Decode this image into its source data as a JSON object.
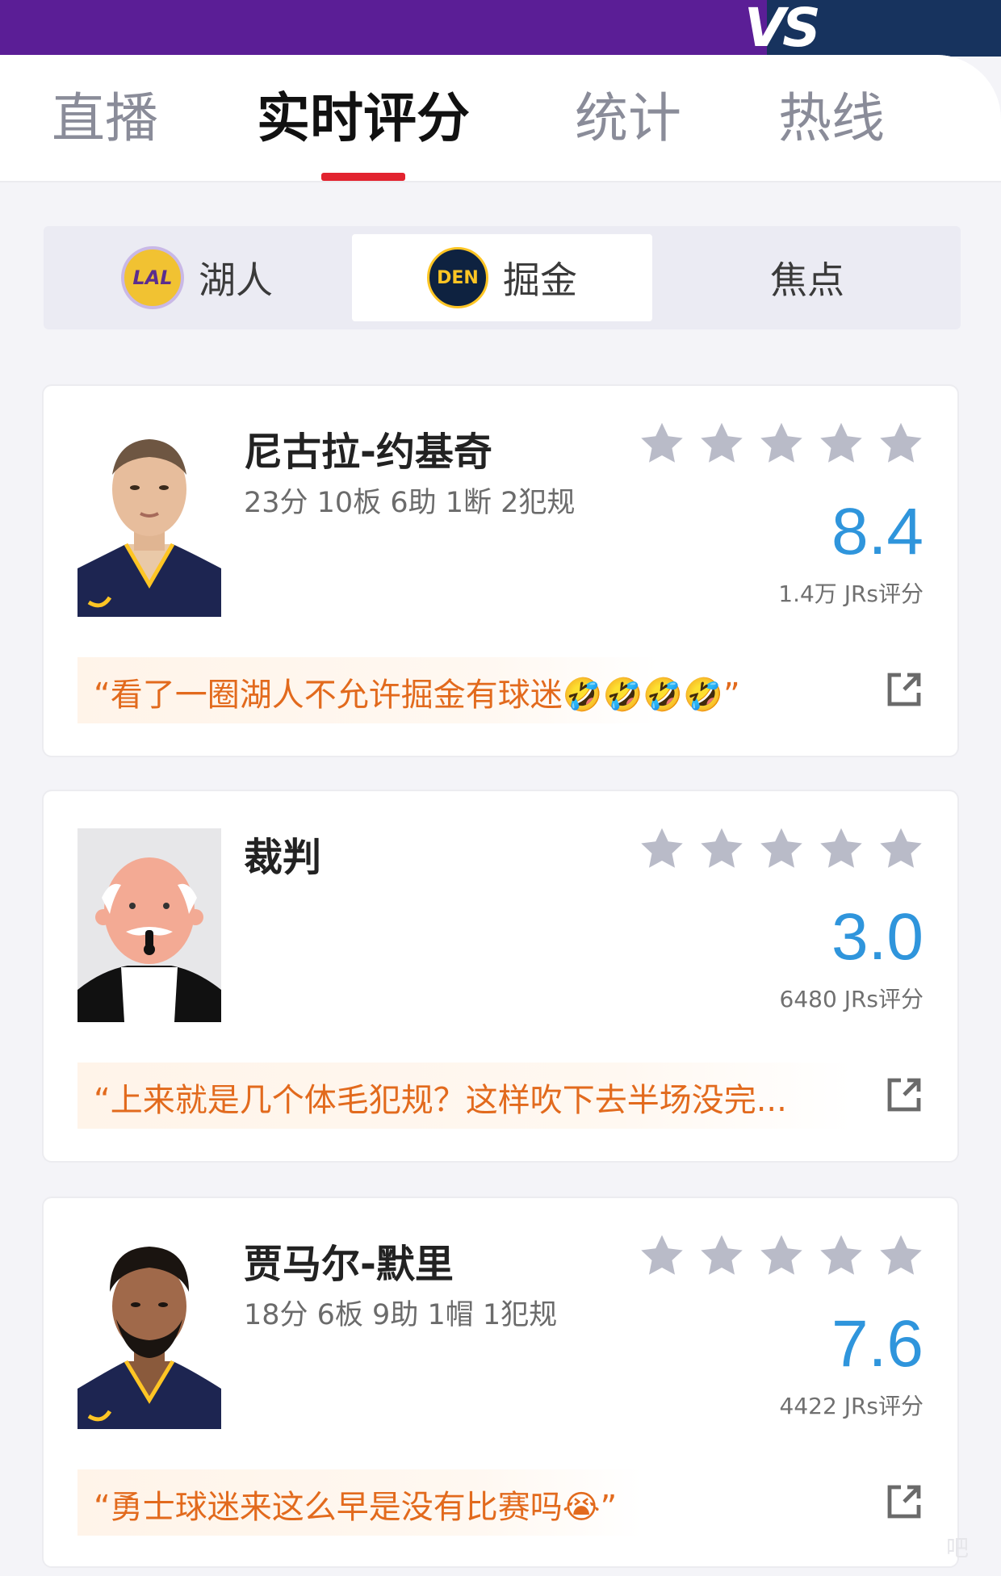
{
  "header": {
    "vs_label": "VS"
  },
  "tabs": [
    {
      "label": "直播"
    },
    {
      "label": "实时评分",
      "active": true
    },
    {
      "label": "统计"
    },
    {
      "label": "热线"
    }
  ],
  "team_switch": [
    {
      "label": "湖人",
      "logo_text": "LAL"
    },
    {
      "label": "掘金",
      "logo_text": "DEN",
      "active": true
    },
    {
      "label": "焦点"
    }
  ],
  "cards": [
    {
      "name": "尼古拉-约基奇",
      "stats": "23分 10板 6助 1断 2犯规",
      "score": "8.4",
      "raters": "1.4万 JRs评分",
      "comment": "“看了一圈湖人不允许掘金有球迷🤣🤣🤣🤣”"
    },
    {
      "name": "裁判",
      "stats": "",
      "score": "3.0",
      "raters": "6480 JRs评分",
      "comment": "“上来就是几个体毛犯规？这样吹下去半场没完..."
    },
    {
      "name": "贾马尔-默里",
      "stats": "18分 6板 9助 1帽 1犯规",
      "score": "7.6",
      "raters": "4422 JRs评分",
      "comment": "“勇士球迷来这么早是没有比赛吗😭”"
    }
  ],
  "colors": {
    "header_purple": "#5b1e96",
    "header_navy": "#17335e",
    "tab_indicator": "#e2232f",
    "score_blue": "#2f95dc",
    "comment_orange": "#e26a1d",
    "star_gray": "#b9bbc8"
  },
  "icons": [
    "star-icon",
    "share-icon",
    "lakers-logo",
    "nuggets-logo",
    "referee-avatar",
    "player-photo"
  ],
  "watermark": "吧"
}
